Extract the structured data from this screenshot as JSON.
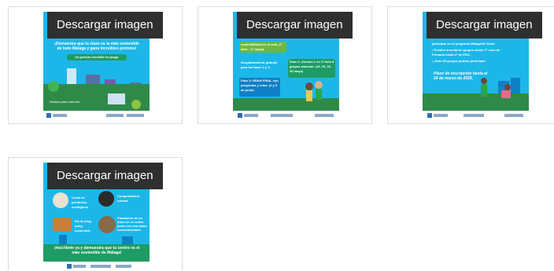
{
  "cards": [
    {
      "button_label": "Descargar imagen",
      "texts": [
        "¡Demuestra que tu clase es la más sostenible de todo Málaga y gana increíbles premios!",
        "Un premio increíble en juego",
        "Desliza para más info"
      ]
    },
    {
      "button_label": "Descargar imagen",
      "texts": [
        "sostenibilidad en el aula. (7 abril - 17 mayo)",
        "Desplazamiento gratuito para las fases 2 y 3.",
        "Fase 2: ¡Duelos 1 vs 1! Solo 8 grupos avanzan. (19, 23, 26, 30 mayo)",
        "Fase 3: GRAN FINAL con preguntas y retos. (2 y 3 de junio)"
      ]
    },
    {
      "button_label": "Descargar imagen",
      "texts": [
        "participar en el programa Málaga40 Verde:",
        "• Pueden inscribirse grupos desde 2º ciclo de Primaria hasta 4º de ESO.",
        "• ¡Solo 60 grupos podrán participar!",
        "Plazo de inscripción hasta el 24 de marzo de 2025."
      ]
    },
    {
      "button_label": "Descargar imagen",
      "texts": [
        "Cesta de productos ecológicos",
        "Compostadora urbana",
        "Kit de ping-pong sostenible",
        "Plantación de un árbol en el centro junto con una placa conmemorativa",
        "¡Inscríbete ya y demuestra que tu centro es el más sostenible de Málaga!"
      ]
    }
  ],
  "colors": {
    "sky": "#1cb7e8",
    "green": "#1e9c63",
    "button_bg": "#2f2f2f",
    "border": "#dcdcdc"
  }
}
